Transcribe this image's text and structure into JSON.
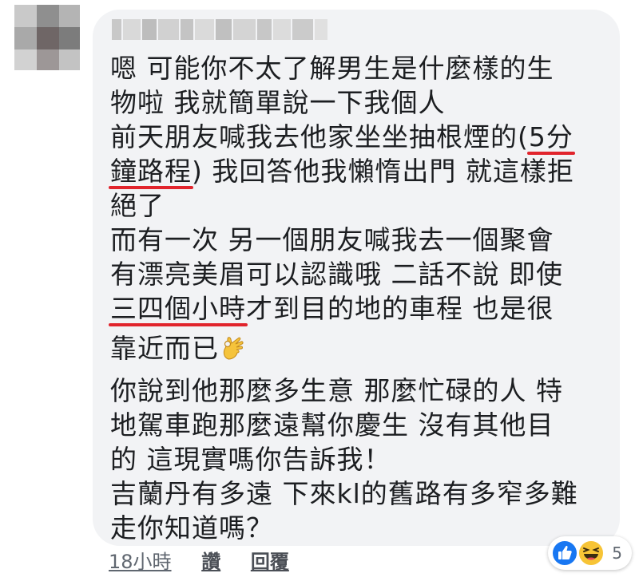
{
  "comment": {
    "lines": [
      {
        "parts": [
          {
            "text": "嗯  可能你不太了解男生是什麼樣的生"
          }
        ]
      },
      {
        "parts": [
          {
            "text": "物啦  我就簡單說一下我個人"
          }
        ]
      },
      {
        "parts": [
          {
            "text": "前天朋友喊我去他家坐坐抽根煙的("
          },
          {
            "text": "5分"
          }
        ]
      },
      {
        "parts": [
          {
            "text": "鐘路程"
          },
          {
            "text": ") 我回答他我懶惰出門  就這樣拒"
          }
        ]
      },
      {
        "parts": [
          {
            "text": "絕了"
          }
        ]
      },
      {
        "parts": [
          {
            "text": "而有一次  另一個朋友喊我去一個聚會"
          }
        ]
      },
      {
        "parts": [
          {
            "text": "有漂亮美眉可以認識哦  二話不說  即使"
          }
        ]
      },
      {
        "parts": [
          {
            "text": "三四個小時"
          },
          {
            "text": "才到目的地的車程  也是很"
          }
        ]
      },
      {
        "parts": [
          {
            "text": "靠近而已"
          }
        ]
      },
      {
        "parts": [
          {
            "text": "你說到他那麼多生意  那麼忙碌的人  特"
          }
        ]
      },
      {
        "parts": [
          {
            "text": "地駕車跑那麼遠幫你慶生  沒有其他目"
          }
        ]
      },
      {
        "parts": [
          {
            "text": "的  這現實嗎你告訴我！"
          }
        ]
      },
      {
        "parts": [
          {
            "text": "吉蘭丹有多遠  下來kl的舊路有多窄多難"
          }
        ]
      },
      {
        "parts": [
          {
            "text": "走你知道嗎？"
          }
        ]
      }
    ],
    "emoji": "ok-hand-emoji"
  },
  "actions": {
    "time": "18小時",
    "like": "讚",
    "reply": "回覆"
  },
  "reactions": {
    "icons": [
      "like-reaction-icon",
      "haha-reaction-icon"
    ],
    "count": "5"
  },
  "colors": {
    "bubble": "#f2f3f5",
    "underline": "#e1242c",
    "like_blue": "#1877f2",
    "haha_yellow": "#f7c436",
    "meta_gray": "#606770"
  }
}
